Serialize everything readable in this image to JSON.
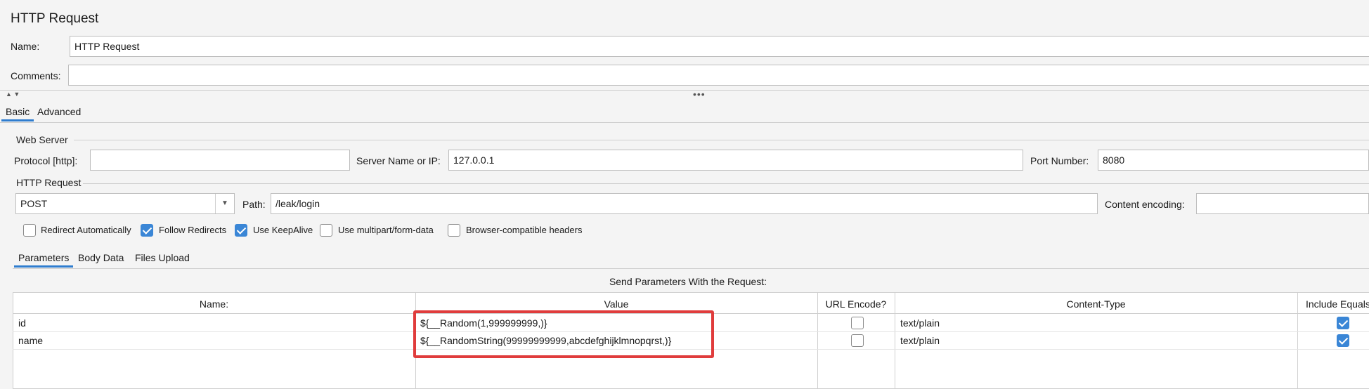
{
  "title": "HTTP Request",
  "name_label": "Name:",
  "name_value": "HTTP Request",
  "comments_label": "Comments:",
  "comments_value": "",
  "top_tabs": [
    {
      "label": "Basic",
      "active": true
    },
    {
      "label": "Advanced",
      "active": false
    }
  ],
  "web_server": {
    "section": "Web Server",
    "protocol_label": "Protocol [http]:",
    "protocol_value": "",
    "server_label": "Server Name or IP:",
    "server_value": "127.0.0.1",
    "port_label": "Port Number:",
    "port_value": "8080"
  },
  "http_request": {
    "section": "HTTP Request",
    "method": "POST",
    "path_label": "Path:",
    "path_value": "/leak/login",
    "encoding_label": "Content encoding:",
    "encoding_value": ""
  },
  "options": [
    {
      "label": "Redirect Automatically",
      "checked": false
    },
    {
      "label": "Follow Redirects",
      "checked": true
    },
    {
      "label": "Use KeepAlive",
      "checked": true
    },
    {
      "label": "Use multipart/form-data",
      "checked": false
    },
    {
      "label": "Browser-compatible headers",
      "checked": false
    }
  ],
  "sub_tabs": [
    {
      "label": "Parameters",
      "active": true
    },
    {
      "label": "Body Data",
      "active": false
    },
    {
      "label": "Files Upload",
      "active": false
    }
  ],
  "params": {
    "caption": "Send Parameters With the Request:",
    "columns": [
      "Name:",
      "Value",
      "URL Encode?",
      "Content-Type",
      "Include Equals?"
    ],
    "rows": [
      {
        "name": "id",
        "value": "${__Random(1,999999999,)}",
        "url_encode": false,
        "content_type": "text/plain",
        "include_equals": true
      },
      {
        "name": "name",
        "value": "${__RandomString(99999999999,abcdefghijklmnopqrst,)}",
        "url_encode": false,
        "content_type": "text/plain",
        "include_equals": true
      }
    ]
  },
  "highlight_color": "#e03c3c",
  "accent_color": "#3a86d6"
}
